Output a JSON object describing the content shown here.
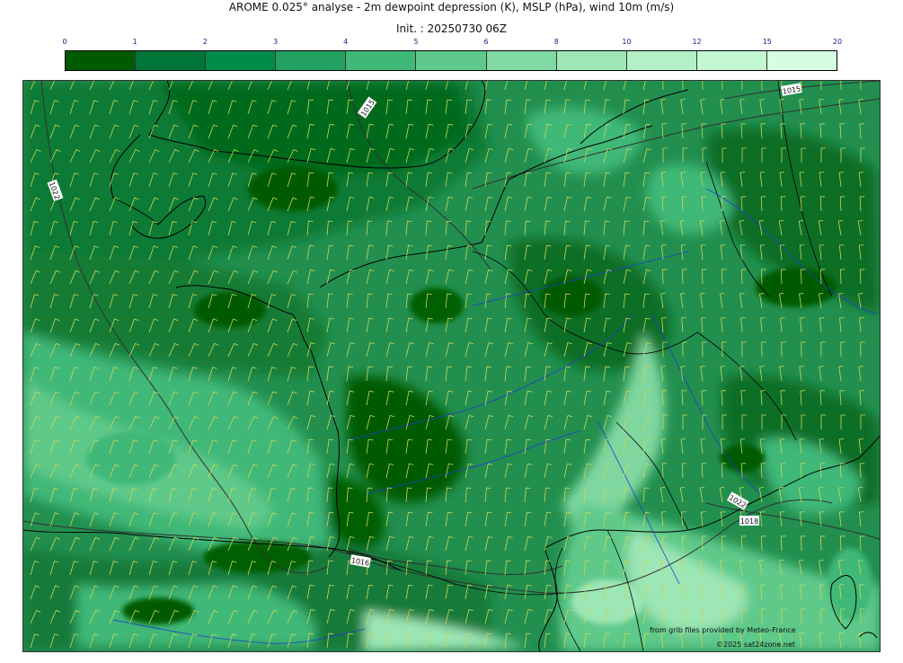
{
  "header": {
    "title": "AROME 0.025° analyse - 2m dewpoint depression (K), MSLP (hPa), wind 10m (m/s)",
    "init": "Init. : 20250730 06Z"
  },
  "legend": {
    "ticks": [
      "0",
      "1",
      "2",
      "3",
      "4",
      "5",
      "6",
      "8",
      "10",
      "12",
      "15",
      "20"
    ],
    "colors": [
      "#005a00",
      "#00753a",
      "#008c4a",
      "#22a060",
      "#3fb878",
      "#5ec98a",
      "#80d8a2",
      "#9de6b5",
      "#b3f0c6",
      "#c3f7d2",
      "#d4fde1"
    ]
  },
  "isobars": {
    "labels": [
      "1015",
      "1022",
      "1016",
      "1022",
      "1015",
      "1018"
    ]
  },
  "credits": {
    "source": "from grib files provided by Meteo-France",
    "copyright": "©2025 sat24zone.net"
  },
  "colors": {
    "coast": "#000000",
    "river": "#1d3fd0",
    "barb": "#c8d85a",
    "isobar": "#303030"
  }
}
